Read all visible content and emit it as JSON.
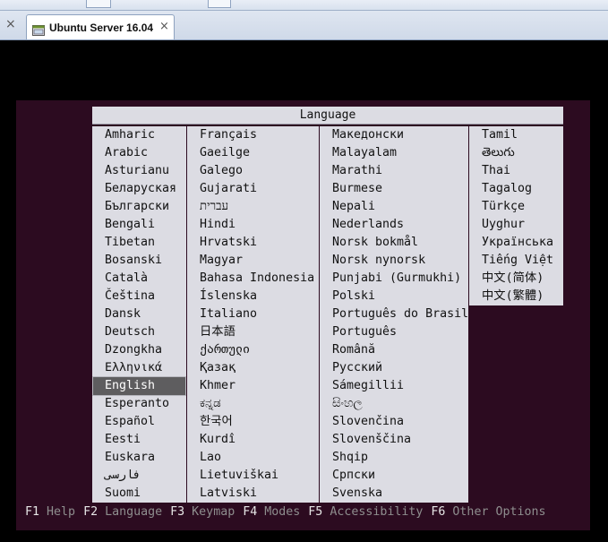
{
  "window": {
    "tab_close_left": "×",
    "tab_title": "Ubuntu Server 16.04",
    "tab_close": "×",
    "tab_icon": "virtual-machine-icon"
  },
  "installer": {
    "title": "Language",
    "columns": [
      [
        "Amharic",
        "Arabic",
        "Asturianu",
        "Беларуская",
        "Български",
        "Bengali",
        "Tibetan",
        "Bosanski",
        "Català",
        "Čeština",
        "Dansk",
        "Deutsch",
        "Dzongkha",
        "Ελληνικά",
        "English",
        "Esperanto",
        "Español",
        "Eesti",
        "Euskara",
        "فارسی",
        "Suomi"
      ],
      [
        "Français",
        "Gaeilge",
        "Galego",
        "Gujarati",
        "עברית",
        "Hindi",
        "Hrvatski",
        "Magyar",
        "Bahasa Indonesia",
        "Íslenska",
        "Italiano",
        "日本語",
        "ქართული",
        "Қазақ",
        "Khmer",
        "ಕನ್ನಡ",
        "한국어",
        "Kurdî",
        "Lao",
        "Lietuviškai",
        "Latviski"
      ],
      [
        "Македонски",
        "Malayalam",
        "Marathi",
        "Burmese",
        "Nepali",
        "Nederlands",
        "Norsk bokmål",
        "Norsk nynorsk",
        "Punjabi (Gurmukhi)",
        "Polski",
        "Português do Brasil",
        "Português",
        "Română",
        "Русский",
        "Sámegillii",
        "සිංහල",
        "Slovenčina",
        "Slovenščina",
        "Shqip",
        "Српски",
        "Svenska"
      ],
      [
        "Tamil",
        "తెలుగు",
        "Thai",
        "Tagalog",
        "Türkçe",
        "Uyghur",
        "Українська",
        "Tiếng Việt",
        "中文(简体)",
        "中文(繁體)"
      ]
    ],
    "selected": "English",
    "function_keys": [
      {
        "key": "F1",
        "label": "Help"
      },
      {
        "key": "F2",
        "label": "Language"
      },
      {
        "key": "F3",
        "label": "Keymap"
      },
      {
        "key": "F4",
        "label": "Modes"
      },
      {
        "key": "F5",
        "label": "Accessibility"
      },
      {
        "key": "F6",
        "label": "Other Options"
      }
    ]
  },
  "colors": {
    "screen_background": "#2c0b20",
    "dialog_background": "#dcdce3",
    "selection": "#5e5d5f"
  }
}
